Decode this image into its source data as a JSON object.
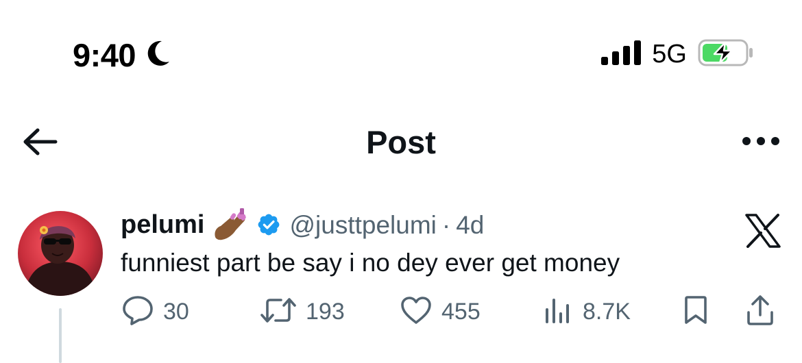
{
  "status_bar": {
    "time": "9:40",
    "focus_icon": "moon-icon",
    "network": "5G",
    "signal_icon": "cellular-signal-icon",
    "battery_icon": "battery-charging-icon",
    "battery_color": "#4cd964"
  },
  "header": {
    "title": "Post",
    "back_icon": "back-arrow-icon",
    "more_icon": "more-horizontal-icon"
  },
  "tweet": {
    "display_name": "pelumi",
    "name_emoji": "nail-polish-emoji",
    "verified_icon": "verified-badge-icon",
    "verified_color": "#1d9bf0",
    "handle": "@justtpelumi",
    "separator": "·",
    "timestamp": "4d",
    "platform_icon": "x-logo-icon",
    "text": "funniest part be say i no dey ever get money",
    "actions": {
      "replies": "30",
      "reposts": "193",
      "likes": "455",
      "views": "8.7K"
    }
  },
  "colors": {
    "primary_text": "#0f1419",
    "secondary_text": "#536471",
    "thread_line": "#cfd9de"
  }
}
